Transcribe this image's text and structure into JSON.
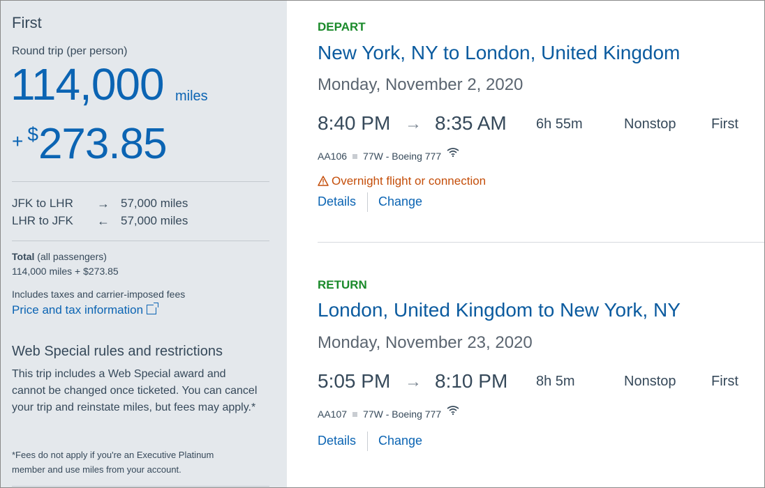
{
  "summary": {
    "cabin": "First",
    "trip_type": "Round trip (per person)",
    "miles": "114,000",
    "miles_unit": "miles",
    "tax_plus": "+",
    "tax_currency": "$",
    "tax_amount": "273.85",
    "legs": [
      {
        "route": "JFK to LHR",
        "arrow": "→",
        "miles": "57,000 miles"
      },
      {
        "route": "LHR to JFK",
        "arrow": "←",
        "miles": "57,000 miles"
      }
    ],
    "total_label": "Total",
    "total_suffix": "(all passengers)",
    "total_value": "114,000 miles + $273.85",
    "fees_note": "Includes taxes and carrier-imposed fees",
    "price_link": "Price and tax information",
    "rules_title": "Web Special rules and restrictions",
    "rules_body": "This trip includes a Web Special award and cannot be changed once ticketed. You can cancel your trip and reinstate miles, but fees may apply.*",
    "fees_footnote": "*Fees do not apply if you're an Executive Platinum member and use miles from your account."
  },
  "flights": [
    {
      "direction": "DEPART",
      "route": "New York, NY to London, United Kingdom",
      "date": "Monday, November 2, 2020",
      "depart_time": "8:40 PM",
      "arrow": "→",
      "arrive_time": "8:35 AM",
      "duration": "6h 55m",
      "stops": "Nonstop",
      "cabin": "First",
      "flight_number": "AA106",
      "aircraft": "77W - Boeing 777",
      "warning": "Overnight flight or connection",
      "details_label": "Details",
      "change_label": "Change"
    },
    {
      "direction": "RETURN",
      "route": "London, United Kingdom to New York, NY",
      "date": "Monday, November 23, 2020",
      "depart_time": "5:05 PM",
      "arrow": "→",
      "arrive_time": "8:10 PM",
      "duration": "8h 5m",
      "stops": "Nonstop",
      "cabin": "First",
      "flight_number": "AA107",
      "aircraft": "77W - Boeing 777",
      "details_label": "Details",
      "change_label": "Change"
    }
  ],
  "icons": {
    "wifi": "wifi-icon",
    "warning": "warning-icon",
    "external_link": "external-link-icon"
  },
  "colors": {
    "brand_blue": "#0b64b3",
    "green_label": "#1a8a2a",
    "warning_orange": "#c44e0a",
    "panel_bg": "#e4e8ec"
  }
}
